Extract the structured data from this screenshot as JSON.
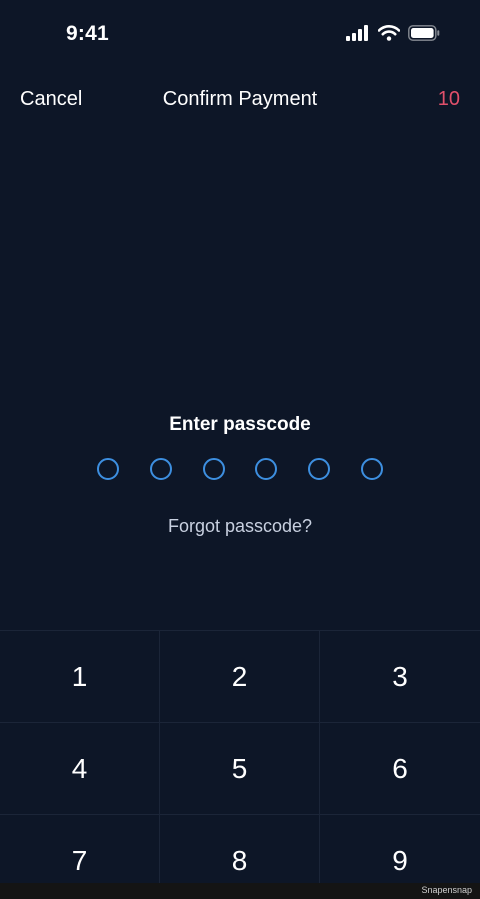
{
  "status_bar": {
    "time": "9:41",
    "icons": [
      "cellular-signal-icon",
      "wifi-icon",
      "battery-icon"
    ]
  },
  "nav": {
    "cancel_label": "Cancel",
    "title": "Confirm Payment",
    "counter": "10"
  },
  "passcode": {
    "prompt": "Enter passcode",
    "digits_total": 6,
    "digits_entered": 0,
    "forgot_label": "Forgot passcode?"
  },
  "keypad": {
    "keys": [
      "1",
      "2",
      "3",
      "4",
      "5",
      "6",
      "7",
      "8",
      "9"
    ]
  },
  "footer": {
    "watermark": "Snapensnap"
  },
  "colors": {
    "background": "#0d1627",
    "accent_blue": "#3d8fe0",
    "counter_red": "#e0506b",
    "text_white": "#ffffff",
    "text_muted": "#c8d0e0",
    "divider": "#1b2538"
  }
}
